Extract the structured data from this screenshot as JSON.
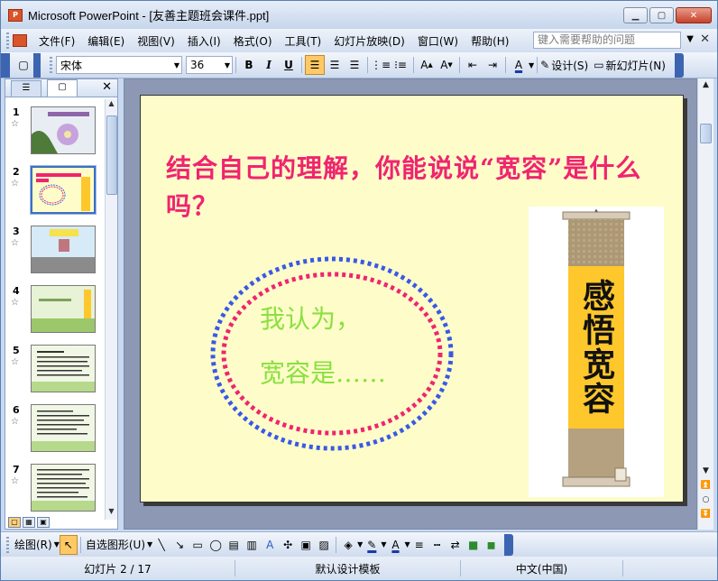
{
  "window": {
    "title": "Microsoft PowerPoint - [友善主题班会课件.ppt]",
    "app_icon_text": "P"
  },
  "menu": {
    "items": [
      "文件(F)",
      "编辑(E)",
      "视图(V)",
      "插入(I)",
      "格式(O)",
      "工具(T)",
      "幻灯片放映(D)",
      "窗口(W)",
      "帮助(H)"
    ],
    "help_placeholder": "键入需要帮助的问题"
  },
  "format_toolbar": {
    "font_name": "宋体",
    "font_size": "36",
    "bold": "B",
    "italic": "I",
    "underline": "U",
    "design_label": "设计(S)",
    "new_slide_label": "新幻灯片(N)"
  },
  "left_panel": {
    "slides": [
      {
        "number": "1",
        "selected": false
      },
      {
        "number": "2",
        "selected": true
      },
      {
        "number": "3",
        "selected": false
      },
      {
        "number": "4",
        "selected": false
      },
      {
        "number": "5",
        "selected": false
      },
      {
        "number": "6",
        "selected": false
      },
      {
        "number": "7",
        "selected": false
      }
    ]
  },
  "slide": {
    "question": "结合自己的理解，你能说说“宽容”是什么吗？",
    "answer_line1": "我认为，",
    "answer_line2": "宽容是……",
    "scroll_text": "感悟宽容"
  },
  "draw_toolbar": {
    "draw_label": "绘图(R)",
    "autoshape_label": "自选图形(U)"
  },
  "status": {
    "slide_pos": "幻灯片 2 / 17",
    "template": "默认设计模板",
    "language": "中文(中国)"
  },
  "colors": {
    "question": "#f0246f",
    "answer": "#8be040",
    "slide_bg": "#fefdc9"
  }
}
